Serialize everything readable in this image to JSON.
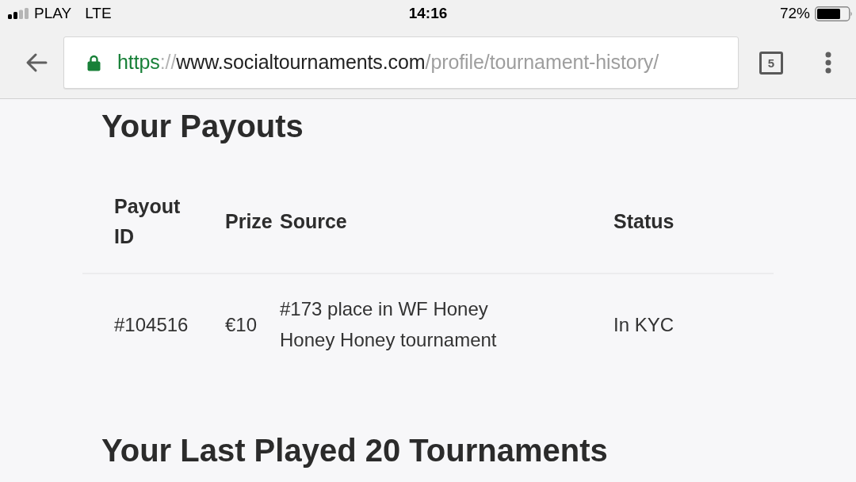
{
  "status_bar": {
    "carrier": "PLAY",
    "network": "LTE",
    "time": "14:16",
    "battery": "72%"
  },
  "browser": {
    "url": {
      "scheme": "https",
      "separator": "://",
      "host": "www.socialtournaments.com",
      "path": "/profile/tournament-history/"
    },
    "tab_count": "5"
  },
  "payouts": {
    "title": "Your Payouts",
    "table": {
      "columns": [
        "Payout ID",
        "Prize",
        "Source",
        "Status"
      ],
      "rows": [
        {
          "payout_id": "#104516",
          "prize": "€10",
          "source": "#173 place in WF Honey Honey Honey tournament",
          "status": "In KYC"
        }
      ]
    }
  },
  "tournaments": {
    "title": "Your Last Played 20 Tournaments"
  }
}
